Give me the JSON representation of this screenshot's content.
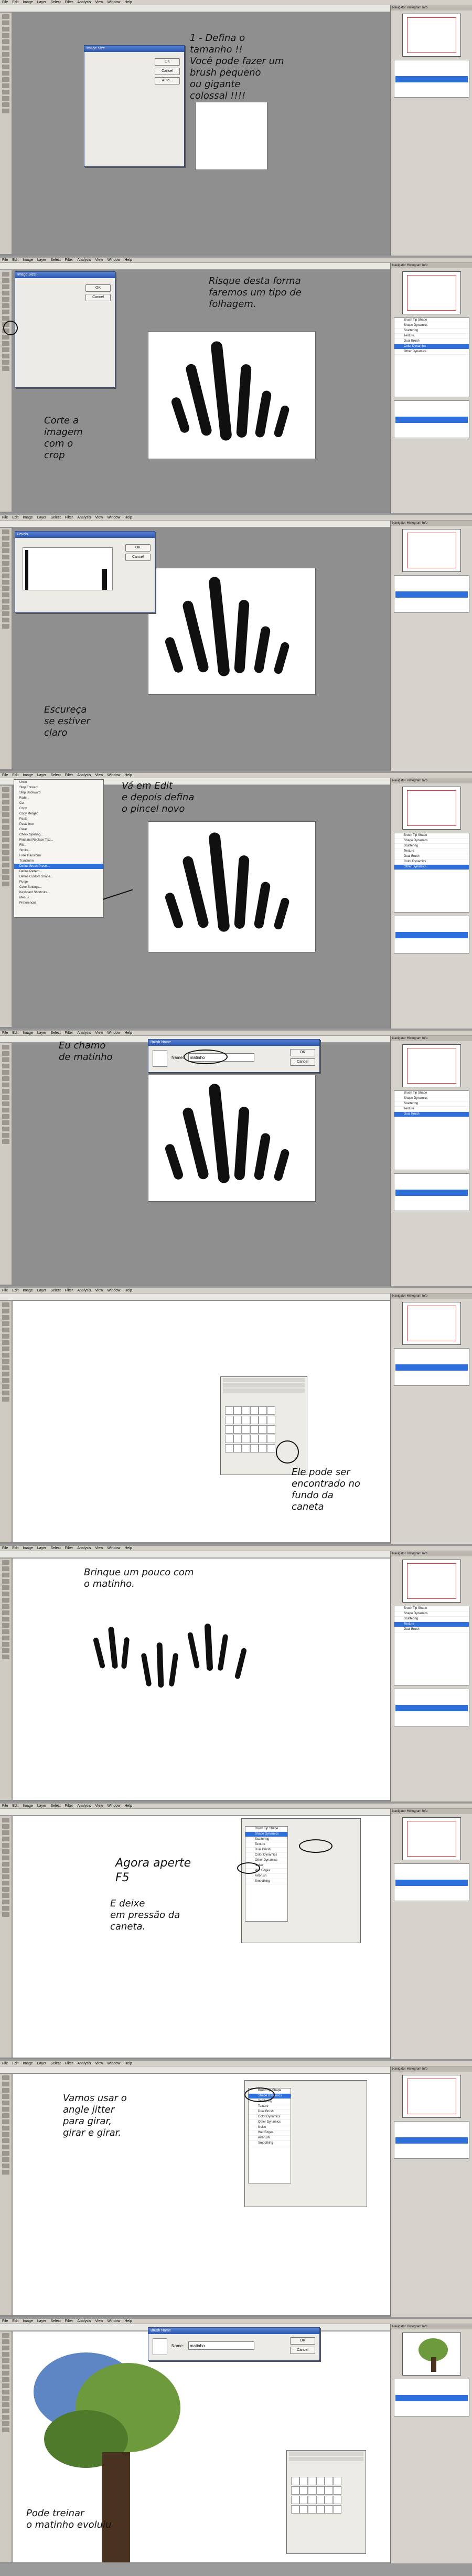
{
  "app": {
    "menu_items": [
      "File",
      "Edit",
      "Image",
      "Layer",
      "Select",
      "Filter",
      "Analysis",
      "View",
      "Window",
      "Help"
    ],
    "panel_tabs": [
      "Navigator",
      "Histogram",
      "Info"
    ],
    "brush_rows": [
      "Brush Tip Shape",
      "Shape Dynamics",
      "Scattering",
      "Texture",
      "Dual Brush",
      "Color Dynamics",
      "Other Dynamics",
      "Noise",
      "Wet Edges",
      "Airbrush",
      "Smoothing"
    ]
  },
  "steps": [
    {
      "note": "1 - Defina o\ntamanho !!\nVocê pode fazer um\nbrush pequeno\nou gigante\ncolossal !!!!"
    },
    {
      "note": "Risque desta forma\nfaremos um tipo de\nfolhagem.",
      "note2": "Corte a\nimagem\ncom o\ncrop"
    },
    {
      "note": "Escureça\nse estiver\nclaro"
    },
    {
      "note": "Vá em Edit\ne depois defina\no pincel novo"
    },
    {
      "note": "Eu chamo\nde matinho"
    },
    {
      "note": "Ele pode ser\nencontrado no\nfundo da\ncaneta"
    },
    {
      "note": "Brinque um pouco com\no matinho."
    },
    {
      "note": "Agora aperte\nF5",
      "note2": "E deixe\nem pressão da\ncaneta."
    },
    {
      "note": "Vamos usar o\nangle jitter\npara girar,\ngirar e girar."
    },
    {
      "note": "Pode treinar\no matinho evoluiu"
    }
  ],
  "dialogs": {
    "image_size": {
      "title": "Image Size",
      "ok": "OK",
      "cancel": "Cancel",
      "auto": "Auto..."
    },
    "levels": {
      "title": "Levels",
      "ok": "OK",
      "cancel": "Cancel"
    },
    "brush_name": {
      "title": "Brush Name",
      "name_label": "Name:",
      "name_value": "matinho",
      "ok": "OK",
      "cancel": "Cancel"
    }
  },
  "edit_menu": [
    "Undo",
    "Step Forward",
    "Step Backward",
    "Fade...",
    "Cut",
    "Copy",
    "Copy Merged",
    "Paste",
    "Paste Into",
    "Clear",
    "Check Spelling...",
    "Find and Replace Text...",
    "Fill...",
    "Stroke...",
    "Free Transform",
    "Transform",
    "Define Brush Preset...",
    "Define Pattern...",
    "Define Custom Shape...",
    "Purge",
    "Color Settings...",
    "Keyboard Shortcuts...",
    "Menus...",
    "Preferences"
  ],
  "edit_menu_highlight": "Define Brush Preset...",
  "colors": {
    "accent": "#2f6fdb",
    "ink": "#111111",
    "canvas": "#ffffff",
    "workspace": "#8f8f8f"
  }
}
